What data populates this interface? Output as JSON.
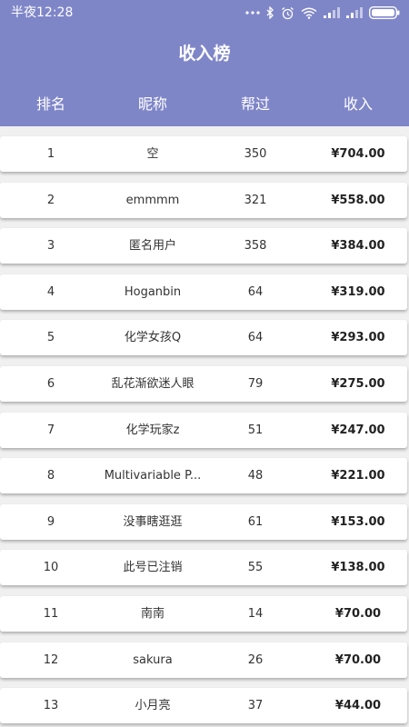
{
  "status_bar": {
    "time": "半夜12:28",
    "icons": [
      "more-dots-icon",
      "bluetooth-icon",
      "alarm-icon",
      "wifi-icon",
      "signal-icon",
      "signal-icon",
      "battery-icon"
    ]
  },
  "header": {
    "title": "收入榜",
    "background_color": "#7f86c8"
  },
  "columns": {
    "rank": "排名",
    "nickname": "昵称",
    "helped": "帮过",
    "income": "收入"
  },
  "rows": [
    {
      "rank": "1",
      "nickname": "空",
      "helped": "350",
      "income": "¥704.00"
    },
    {
      "rank": "2",
      "nickname": "emmmm",
      "helped": "321",
      "income": "¥558.00"
    },
    {
      "rank": "3",
      "nickname": "匿名用户",
      "helped": "358",
      "income": "¥384.00"
    },
    {
      "rank": "4",
      "nickname": "Hoganbin",
      "helped": "64",
      "income": "¥319.00"
    },
    {
      "rank": "5",
      "nickname": "化学女孩Q",
      "helped": "64",
      "income": "¥293.00"
    },
    {
      "rank": "6",
      "nickname": "乱花渐欲迷人眼",
      "helped": "79",
      "income": "¥275.00"
    },
    {
      "rank": "7",
      "nickname": "化学玩家z",
      "helped": "51",
      "income": "¥247.00"
    },
    {
      "rank": "8",
      "nickname": "Multivariable P...",
      "helped": "48",
      "income": "¥221.00"
    },
    {
      "rank": "9",
      "nickname": "没事瞎逛逛",
      "helped": "61",
      "income": "¥153.00"
    },
    {
      "rank": "10",
      "nickname": "此号已注销",
      "helped": "55",
      "income": "¥138.00"
    },
    {
      "rank": "11",
      "nickname": "南南",
      "helped": "14",
      "income": "¥70.00"
    },
    {
      "rank": "12",
      "nickname": "sakura",
      "helped": "26",
      "income": "¥70.00"
    },
    {
      "rank": "13",
      "nickname": "小月亮",
      "helped": "37",
      "income": "¥44.00"
    }
  ]
}
